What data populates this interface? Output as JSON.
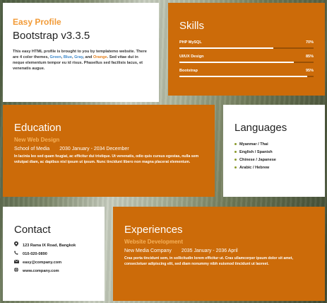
{
  "profile": {
    "label": "Easy Profile",
    "title": "Bootstrap v3.3.5",
    "desc_part1": "This easy HTML profile is brought to you by templatemo website. There are 4 color themes, ",
    "theme_green": "Green",
    "comma1": ", ",
    "theme_blue": "Blue",
    "comma2": ", ",
    "theme_gray": "Gray",
    "and": ", and ",
    "theme_orange": "Orange",
    "desc_part2": ". Sed vitae dui in neque elementum tempor eu id risus. Phasellus sed facilisis lacus, et venenatis augue."
  },
  "skills": {
    "title": "Skills",
    "items": [
      {
        "name": "PHP MySQL",
        "percent_label": "70%",
        "level": 0.7
      },
      {
        "name": "UI/UX Design",
        "percent_label": "85%",
        "level": 0.85
      },
      {
        "name": "Bootstrap",
        "percent_label": "95%",
        "level": 0.95
      }
    ]
  },
  "education": {
    "title": "Education",
    "subtitle": "New Web Design",
    "school": "School of Media",
    "period": "2030 January - 2034 December",
    "text": "In lacinia leo sed quam feugiat, ac efficitur dui tristique. Ut venenatis, odio quis cursus egestas, nulla sem volutpat diam, ac dapibus nisl ipsum ut ipsum. Nunc tincidunt libero non magna placerat elementum."
  },
  "languages": {
    "title": "Languages",
    "items": [
      "Myanmar / Thai",
      "English / Spanish",
      "Chinese / Japanese",
      "Arabic / Hebrew"
    ]
  },
  "contact": {
    "title": "Contact",
    "address": "123 Rama IX Road, Bangkok",
    "phone": "010-020-0890",
    "email": "easy@company.com",
    "website": "www.company.com"
  },
  "experiences": {
    "title": "Experiences",
    "subtitle": "Website Development",
    "company": "New Media Company",
    "period": "2035 January - 2036 April",
    "text": "Cras porta tincidunt sem, in sollicitudin lorem efficitur ut. Cras ullamcorper ipsum dolor sit amet, consectetuer adipiscing elit, sed diam nonummy nibh euismod tincidunt ut laoreet."
  },
  "colors": {
    "accent_orange": "#cc6b09",
    "label_orange": "#f29b38",
    "link_blue": "#3a86c8"
  }
}
